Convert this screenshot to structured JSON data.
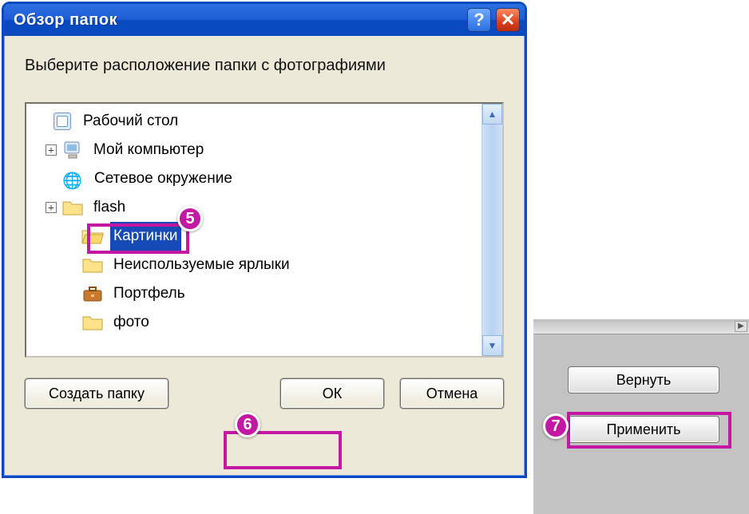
{
  "dialog": {
    "title": "Обзор папок",
    "instruction": "Выберите расположение папки с фотографиями",
    "tree": [
      {
        "icon": "desktop",
        "label": "Рабочий стол",
        "indent": 0,
        "expander": ""
      },
      {
        "icon": "computer",
        "label": "Мой компьютер",
        "indent": 1,
        "expander": "+"
      },
      {
        "icon": "network",
        "label": "Сетевое окружение",
        "indent": 1,
        "expander": ""
      },
      {
        "icon": "folder",
        "label": "flash",
        "indent": 1,
        "expander": "+"
      },
      {
        "icon": "folder-open",
        "label": "Картинки",
        "indent": 2,
        "expander": "",
        "selected": true
      },
      {
        "icon": "folder",
        "label": "Неиспользуемые ярлыки",
        "indent": 2,
        "expander": ""
      },
      {
        "icon": "briefcase",
        "label": "Портфель",
        "indent": 2,
        "expander": ""
      },
      {
        "icon": "folder",
        "label": "фото",
        "indent": 2,
        "expander": ""
      }
    ],
    "buttons": {
      "new_folder": "Создать папку",
      "ok": "ОК",
      "cancel": "Отмена"
    }
  },
  "side": {
    "revert": "Вернуть",
    "apply": "Применить"
  },
  "annotations": {
    "5": "5",
    "6": "6",
    "7": "7"
  }
}
